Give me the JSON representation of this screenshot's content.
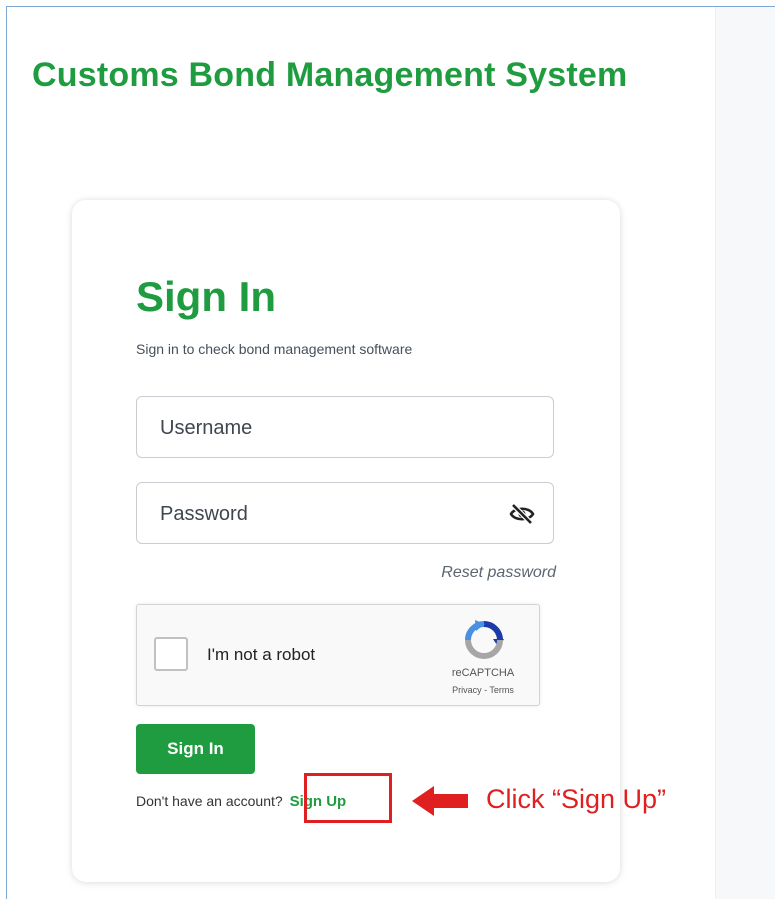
{
  "app": {
    "title": "Customs Bond Management System"
  },
  "signin": {
    "title": "Sign In",
    "subtitle": "Sign in to check bond management software",
    "username_placeholder": "Username",
    "password_placeholder": "Password",
    "reset_link": "Reset password",
    "button_label": "Sign In",
    "no_account_text": "Don't have an account?",
    "signup_link": "Sign Up"
  },
  "recaptcha": {
    "label": "I'm not a robot",
    "brand": "reCAPTCHA",
    "terms": "Privacy - Terms"
  },
  "annotation": {
    "callout": "Click “Sign Up”",
    "color": "#e02020"
  },
  "colors": {
    "brand_green": "#1e9c3f"
  },
  "icons": {
    "password_toggle": "eye-slash-icon",
    "recaptcha_logo": "recaptcha-logo-icon",
    "arrow": "left-arrow-icon"
  }
}
